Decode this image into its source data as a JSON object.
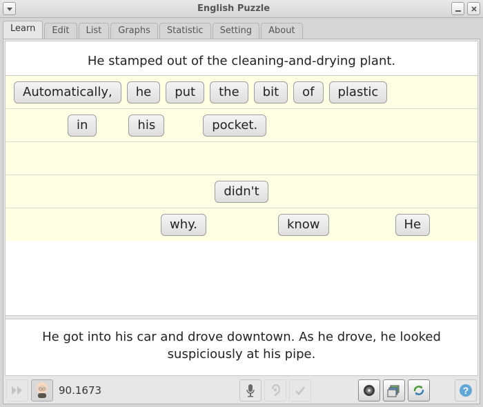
{
  "window": {
    "title": "English Puzzle"
  },
  "tabs": [
    {
      "label": "Learn",
      "active": true
    },
    {
      "label": "Edit"
    },
    {
      "label": "List"
    },
    {
      "label": "Graphs"
    },
    {
      "label": "Statistic"
    },
    {
      "label": "Setting"
    },
    {
      "label": "About"
    }
  ],
  "sentence_top": "He stamped out of the cleaning-and-drying plant.",
  "rows": [
    {
      "words": [
        "Automatically,",
        "he",
        "put",
        "the",
        "bit",
        "of",
        "plastic"
      ]
    },
    {
      "words": [
        "in",
        "his",
        "pocket."
      ],
      "offsets": [
        70,
        30,
        40
      ]
    },
    {
      "words": []
    },
    {
      "words": [
        "didn't"
      ],
      "center": true
    },
    {
      "words": [
        "why.",
        "know",
        "He"
      ],
      "spread": [
        205,
        88,
        80
      ]
    }
  ],
  "sentence_bottom": "He got into his car and drove downtown. As he drove, he looked suspiciously at his pipe.",
  "toolbar": {
    "score": "90.1673",
    "icons": {
      "play": "play-icon",
      "avatar": "avatar-icon",
      "mic": "microphone-icon",
      "ear": "ear-icon",
      "check": "check-icon",
      "speaker": "speaker-icon",
      "images": "images-icon",
      "refresh": "refresh-icon",
      "help": "help-icon"
    }
  }
}
